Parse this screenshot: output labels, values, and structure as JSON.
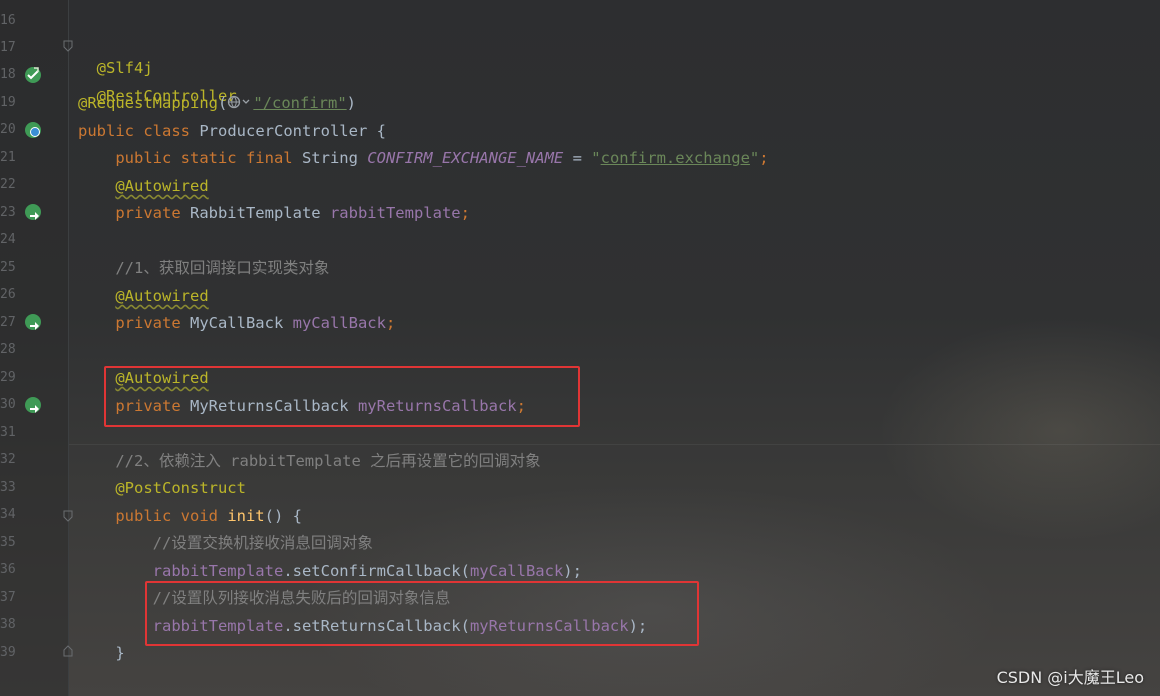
{
  "editor": {
    "line_numbers": [
      "16",
      "17",
      "18",
      "19",
      "20",
      "21",
      "22",
      "23",
      "24",
      "25",
      "26",
      "27",
      "28",
      "29",
      "30",
      "31",
      "32",
      "33",
      "34",
      "35",
      "36",
      "37",
      "38",
      "39"
    ],
    "lines": {
      "l17": {
        "ann": "@Slf4j"
      },
      "l18": {
        "ann": "@RestController"
      },
      "l19": {
        "ann": "@RequestMapping",
        "paren_open": "(",
        "icon": "globe-icon",
        "str": "\"/confirm\"",
        "paren_close": ")"
      },
      "l20": {
        "kw": "public class ",
        "name": "ProducerController {"
      },
      "l21": {
        "kw": "public static final ",
        "type": "String ",
        "field": "CONFIRM_EXCHANGE_NAME",
        "eq": " = ",
        "q1": "\"",
        "str": "confirm.exchange",
        "q2": "\"",
        "semi": ";"
      },
      "l22": {
        "ann": "@Autowired"
      },
      "l23": {
        "kw": "private ",
        "type": "RabbitTemplate ",
        "field": "rabbitTemplate",
        "semi": ";"
      },
      "l25": {
        "comment": "//1、获取回调接口实现类对象"
      },
      "l26": {
        "ann": "@Autowired"
      },
      "l27": {
        "kw": "private ",
        "type": "MyCallBack ",
        "field": "myCallBack",
        "semi": ";"
      },
      "l29": {
        "ann": "@Autowired"
      },
      "l30": {
        "kw": "private ",
        "type": "MyReturnsCallback ",
        "field": "myReturnsCallback",
        "semi": ";"
      },
      "l32": {
        "comment": "//2、依赖注入 rabbitTemplate 之后再设置它的回调对象"
      },
      "l33": {
        "ann": "@PostConstruct"
      },
      "l34": {
        "kw": "public void ",
        "fn": "init",
        "rest": "() {"
      },
      "l35": {
        "comment": "//设置交换机接收消息回调对象"
      },
      "l36": {
        "obj": "rabbitTemplate",
        "call": ".setConfirmCallback(",
        "arg": "myCallBack",
        "end": ");"
      },
      "l37": {
        "comment": "//设置队列接收消息失败后的回调对象信息"
      },
      "l38": {
        "obj": "rabbitTemplate",
        "call": ".setReturnsCallback(",
        "arg": "myReturnsCallback",
        "end": ");"
      },
      "l39": {
        "brace": "}"
      }
    },
    "gutter_icons": {
      "l18": "bean-check-icon",
      "l20": "bean-class-icon",
      "l23": "bean-injection-icon",
      "l27": "bean-injection-icon",
      "l30": "bean-injection-icon"
    },
    "highlight_color": "#e03535"
  },
  "colors": {
    "background": "#2b2b2b",
    "keyword": "#cc7832",
    "annotation": "#bbb529",
    "field": "#9876aa",
    "string": "#6a8759",
    "comment": "#808080",
    "method": "#ffc66d",
    "text": "#a9b7c6"
  },
  "watermark": "CSDN @i大魔王Leo"
}
